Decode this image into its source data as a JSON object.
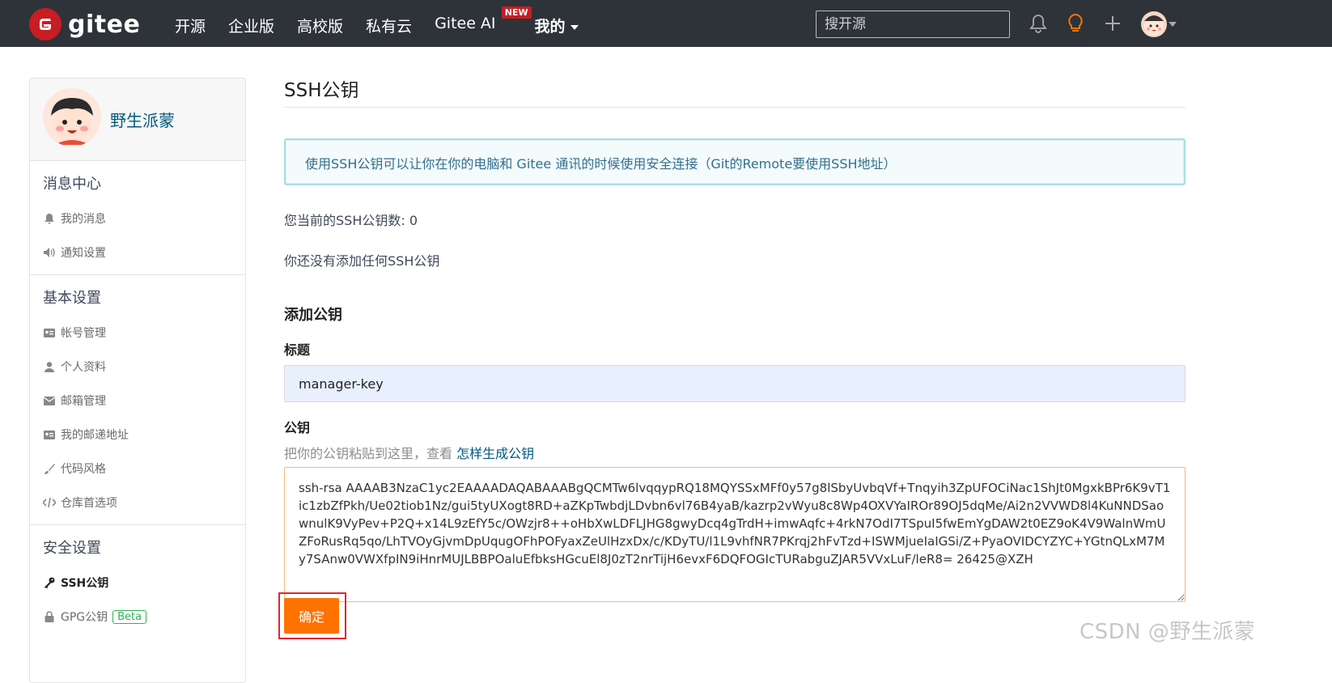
{
  "brand": {
    "name": "gitee",
    "color": "#c71d23"
  },
  "nav": {
    "items": [
      "开源",
      "企业版",
      "高校版",
      "私有云",
      "Gitee AI"
    ],
    "new_badge": "NEW",
    "mine": "我的",
    "search_placeholder": "搜开源"
  },
  "sidebar": {
    "user_name": "野生派蒙",
    "sections": [
      {
        "title": "消息中心",
        "items": [
          "我的消息",
          "通知设置"
        ]
      },
      {
        "title": "基本设置",
        "items": [
          "帐号管理",
          "个人资料",
          "邮箱管理",
          "我的邮递地址",
          "代码风格",
          "仓库首选项"
        ]
      },
      {
        "title": "安全设置",
        "items": [
          "SSH公钥",
          "GPG公钥"
        ]
      }
    ],
    "beta": "Beta"
  },
  "main": {
    "title": "SSH公钥",
    "alert": "使用SSH公钥可以让你在你的电脑和 Gitee 通讯的时候使用安全连接（Git的Remote要使用SSH地址）",
    "count_text": "您当前的SSH公钥数: 0",
    "empty_text": "你还没有添加任何SSH公钥",
    "add_heading": "添加公钥",
    "title_label": "标题",
    "title_value": "manager-key",
    "key_label": "公钥",
    "hint_text": "把你的公钥粘贴到这里，查看 ",
    "hint_link": "怎样生成公钥",
    "key_value": "ssh-rsa AAAAB3NzaC1yc2EAAAADAQABAAABgQCMTw6lvqqypRQ18MQYSSxMFf0y57g8lSbyUvbqVf+Tnqyih3ZpUFOCiNac1ShJt0MgxkBPr6K9vT1ic1zbZfPkh/Ue02tiob1Nz/gui5tyUXogt8RD+aZKpTwbdjLDvbn6vl76B4yaB/kazrp2vWyu8c8Wp4OXVYaIROr89OJ5dqMe/Ai2n2VVWD8l4KuNNDSaownulK9VyPev+P2Q+x14L9zEfY5c/OWzjr8++oHbXwLDFLJHG8gwyDcq4gTrdH+imwAqfc+4rkN7OdI7TSpuI5fwEmYgDAW2t0EZ9oK4V9WalnWmUZFoRusRq5qo/LhTVOyGjvmDpUqugOFhPOFyaxZeUlHzxDx/c/KDyTU/l1L9vhfNR7PKrqj2hFvTzd+ISWMjueIaIGSi/Z+PyaOVIDCYZYC+YGtnQLxM7My7SAnw0VWXfpIN9iHnrMUJLBBPOaluEfbksHGcuEl8J0zT2nrTijH6evxF6DQFOGIcTURabguZJAR5VVxLuF/leR8= 26425@XZH",
    "confirm": "确定"
  },
  "watermark": "CSDN @野生派蒙",
  "colors": {
    "topbar": "#2e3339",
    "accent": "#fe7300",
    "link": "#005980"
  }
}
